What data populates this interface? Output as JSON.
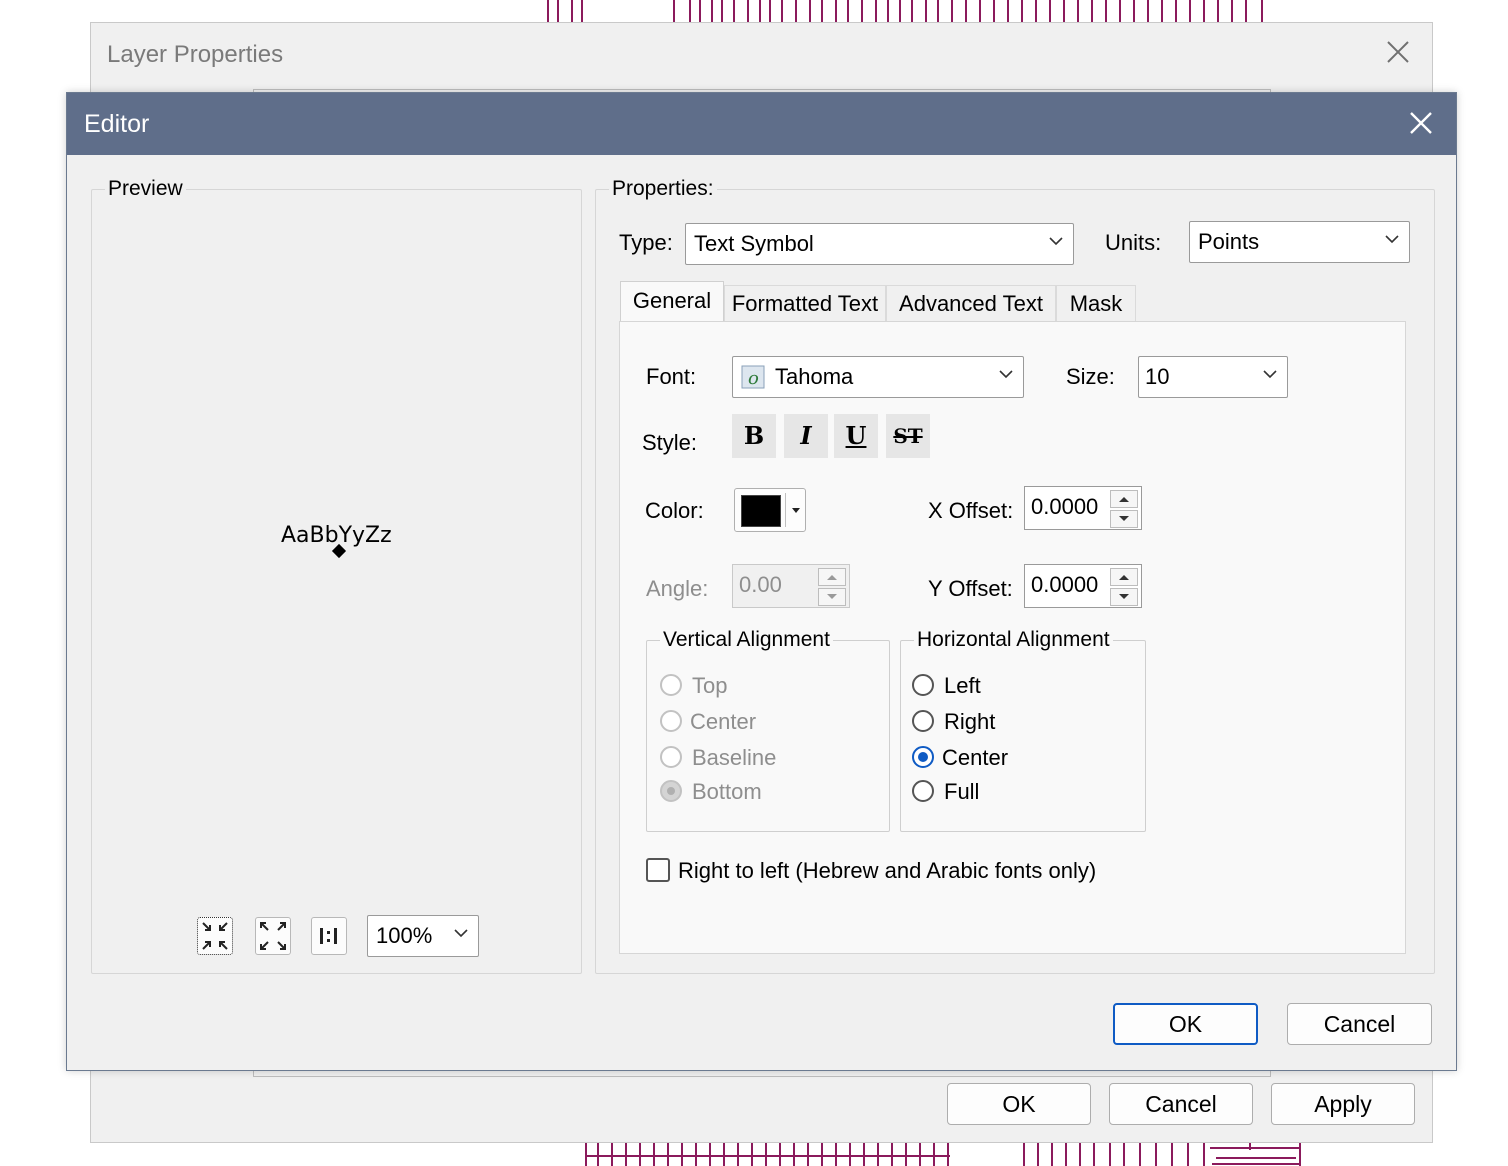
{
  "layer_properties": {
    "title": "Layer Properties",
    "ok_label": "OK",
    "cancel_label": "Cancel",
    "apply_label": "Apply"
  },
  "editor": {
    "title": "Editor",
    "preview": {
      "label": "Preview",
      "sample_text": "AaBbYyZz",
      "zoom": "100%"
    },
    "properties": {
      "label": "Properties:",
      "type_label": "Type:",
      "type_value": "Text Symbol",
      "units_label": "Units:",
      "units_value": "Points",
      "tabs": [
        "General",
        "Formatted Text",
        "Advanced Text",
        "Mask"
      ],
      "general": {
        "font_label": "Font:",
        "font_value": "Tahoma",
        "size_label": "Size:",
        "size_value": "10",
        "style_label": "Style:",
        "style_buttons": [
          "B",
          "I",
          "U",
          "ST"
        ],
        "color_label": "Color:",
        "color_value": "#000000",
        "x_offset_label": "X Offset:",
        "x_offset_value": "0.0000",
        "angle_label": "Angle:",
        "angle_value": "0.00",
        "y_offset_label": "Y Offset:",
        "y_offset_value": "0.0000",
        "vertical_alignment": {
          "label": "Vertical Alignment",
          "options": [
            "Top",
            "Center",
            "Baseline",
            "Bottom"
          ],
          "selected": "Bottom",
          "enabled": false
        },
        "horizontal_alignment": {
          "label": "Horizontal Alignment",
          "options": [
            "Left",
            "Right",
            "Center",
            "Full"
          ],
          "selected": "Center"
        },
        "rtl_label": "Right to left (Hebrew and Arabic fonts only)",
        "rtl_checked": false
      }
    },
    "ok_label": "OK",
    "cancel_label": "Cancel"
  },
  "colors": {
    "titlebar": "#5f6e8a",
    "accent": "#0f5bc4",
    "map_lines": "#8b1a5c"
  }
}
